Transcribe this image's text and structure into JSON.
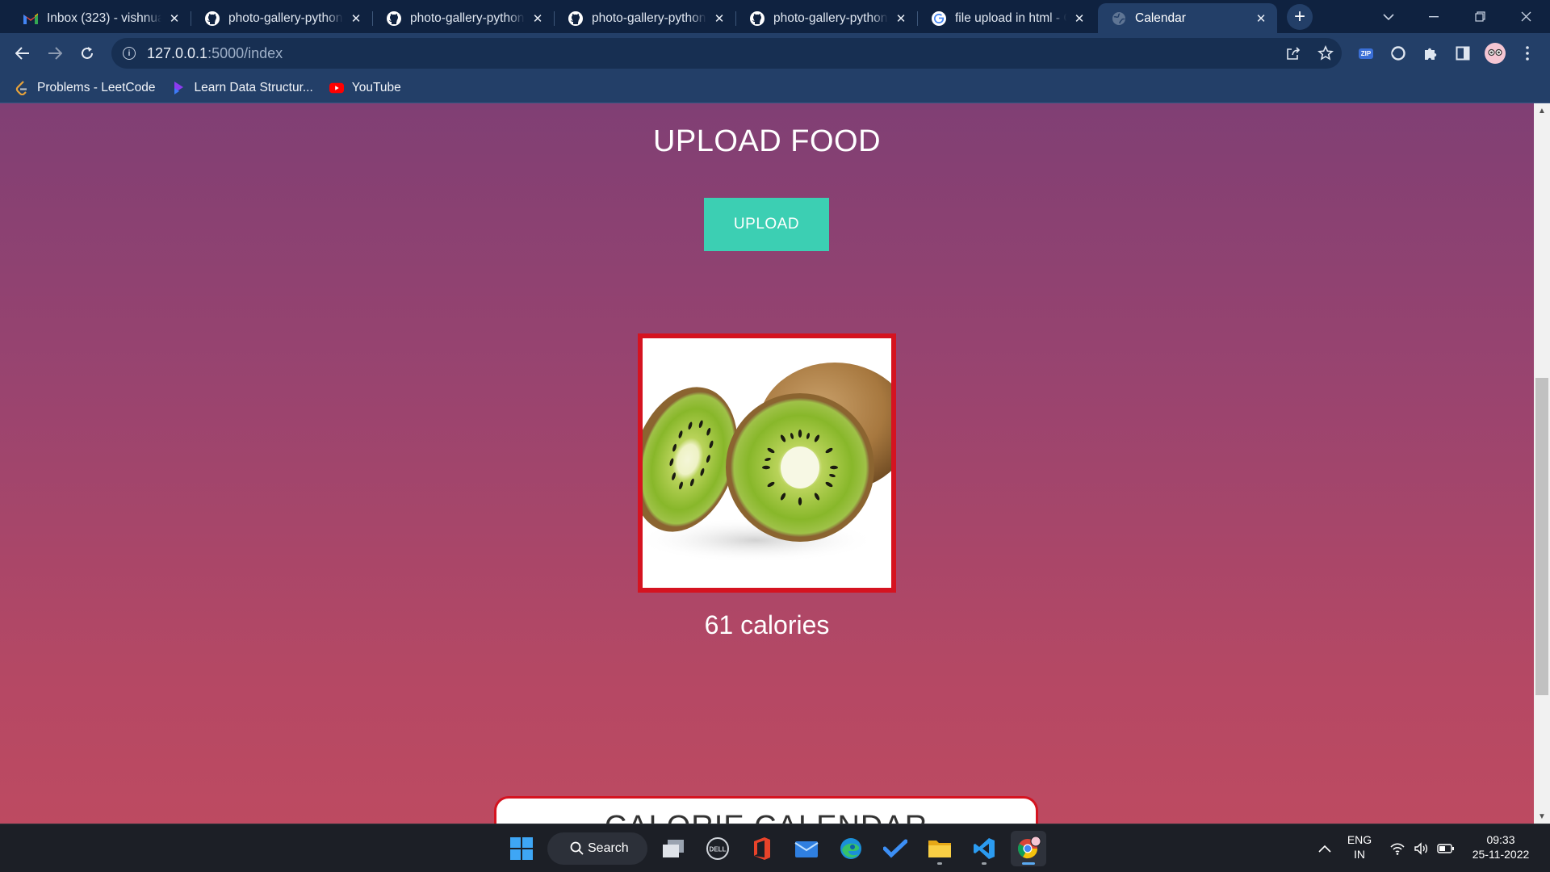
{
  "browser": {
    "tabs": [
      {
        "title": "Inbox (323) - vishnua",
        "icon": "gmail-icon"
      },
      {
        "title": "photo-gallery-python",
        "icon": "github-icon"
      },
      {
        "title": "photo-gallery-python",
        "icon": "github-icon"
      },
      {
        "title": "photo-gallery-python",
        "icon": "github-icon"
      },
      {
        "title": "photo-gallery-python",
        "icon": "github-icon"
      },
      {
        "title": "file upload in html - G",
        "icon": "google-icon"
      },
      {
        "title": "Calendar",
        "icon": "globe-icon"
      }
    ],
    "active_tab": "Calendar",
    "url_host": "127.0.0.1",
    "url_path": ":5000/index",
    "extension_zip_label": "ZIP",
    "bookmarks": [
      {
        "label": "Problems - LeetCode",
        "icon": "leetcode-icon"
      },
      {
        "label": "Learn Data Structur...",
        "icon": "learn-icon"
      },
      {
        "label": "YouTube",
        "icon": "youtube-icon"
      }
    ]
  },
  "page": {
    "title": "UPLOAD FOOD",
    "upload_label": "UPLOAD",
    "food_image": "kiwi-fruit-image",
    "calories_text": "61 calories",
    "calendar_title": "CALORIE CALENDAR"
  },
  "taskbar": {
    "search_label": "Search",
    "lang_top": "ENG",
    "lang_bottom": "IN",
    "time": "09:33",
    "date": "25-11-2022"
  },
  "colors": {
    "tab_strip": "#0f2240",
    "toolbar": "#233f68",
    "page_gradient_top": "#803f74",
    "page_gradient_bottom": "#bd4a61",
    "upload_button": "#3ccfb3",
    "image_border": "#d51320",
    "taskbar": "#1c1f26"
  }
}
